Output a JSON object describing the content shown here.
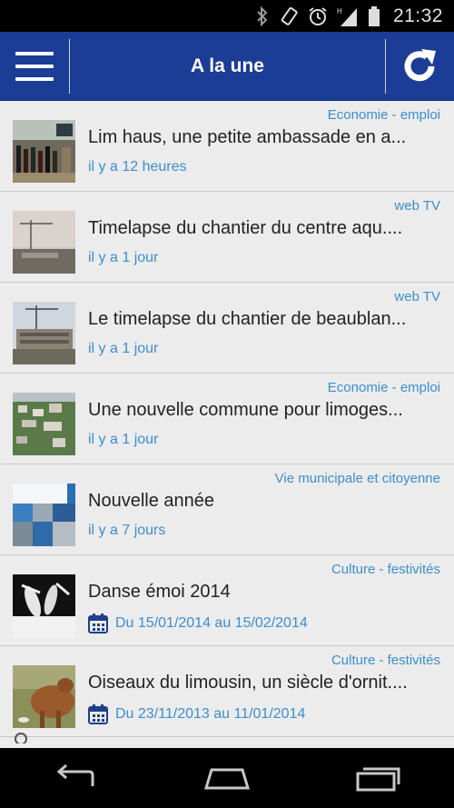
{
  "status": {
    "time": "21:32"
  },
  "header": {
    "title": "A la une"
  },
  "items": [
    {
      "category": "Economie - emploi",
      "title": "Lim haus, une petite ambassade en a...",
      "meta": "il y a 12 heures"
    },
    {
      "category": "web TV",
      "title": "Timelapse du chantier du centre aqu....",
      "meta": "il y a 1 jour"
    },
    {
      "category": "web TV",
      "title": "Le timelapse du chantier de beaublan...",
      "meta": "il y a 1 jour"
    },
    {
      "category": "Economie - emploi",
      "title": "Une nouvelle commune pour limoges...",
      "meta": "il y a 1 jour"
    },
    {
      "category": "Vie municipale et citoyenne",
      "title": "Nouvelle année",
      "meta": "il y a 7 jours"
    },
    {
      "category": "Culture - festivités",
      "title": "Danse émoi 2014",
      "meta": "Du 15/01/2014 au 15/02/2014"
    },
    {
      "category": "Culture - festivités",
      "title": "Oiseaux du limousin, un siècle d'ornit....",
      "meta": "Du 23/11/2013 au 11/01/2014"
    }
  ],
  "icons": {
    "menu": "hamburger-icon",
    "refresh": "refresh-icon",
    "calendar": "calendar-icon",
    "back": "back-icon",
    "home": "home-icon",
    "recents": "recents-icon"
  },
  "colors": {
    "app_bar": "#1b3d96",
    "accent": "#3b8ed1",
    "background": "#ececec"
  }
}
